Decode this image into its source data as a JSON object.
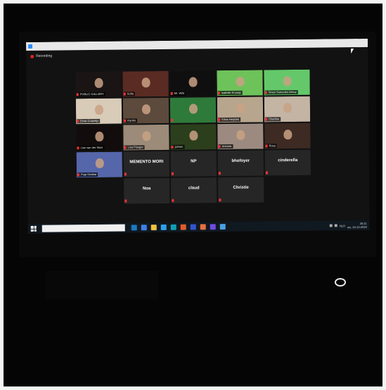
{
  "window": {
    "recording_label": "Recording"
  },
  "gallery": {
    "rows": [
      [
        {
          "name": "PUBLIC GALLERY",
          "video": "#1a1414"
        },
        {
          "name": "Sofia",
          "video": "#5a2b22"
        },
        {
          "name": "Mr. Wild",
          "video": "#0f0f0f"
        },
        {
          "name": "Isabelle Snoeijs",
          "video": "#6ec25a"
        },
        {
          "name": "Sinan Semerdzi Aksoy",
          "video": "#64c86a"
        }
      ],
      [
        {
          "name": "Ernst Corpelijn",
          "video": "#d8cbb8"
        },
        {
          "name": "mynke",
          "video": "#5c4a3c"
        },
        {
          "name": "",
          "video": "#2e7a3a"
        },
        {
          "name": "Silvia Heijstek",
          "video": "#b8a58d"
        },
        {
          "name": "Charline",
          "video": "#c4b4a4"
        }
      ],
      [
        {
          "name": "Lise van der Sluis",
          "video": "#120c0c"
        },
        {
          "name": "Lisa Ploeger",
          "video": "#9b8b78"
        },
        {
          "name": "jaimen",
          "video": "#2b3f1c"
        },
        {
          "name": "Antonia",
          "video": "#9c8a80"
        },
        {
          "name": "Rosa",
          "video": "#3d2a22"
        }
      ],
      [
        {
          "name": "Puja Sivakar",
          "video": "#5566aa"
        },
        {
          "name": "MEMENTO MORI",
          "video": ""
        },
        {
          "name": "NP",
          "video": ""
        },
        {
          "name": "bhofoyer",
          "video": ""
        },
        {
          "name": "cinderella",
          "video": ""
        }
      ],
      [
        {
          "name": "Noa",
          "video": ""
        },
        {
          "name": "claud",
          "video": ""
        },
        {
          "name": "Christie",
          "video": ""
        }
      ]
    ]
  },
  "taskbar": {
    "apps": [
      "#1a78c2",
      "#3f7ee8",
      "#f0c040",
      "#2ea0e8",
      "#10a0b0",
      "#e25b2a",
      "#3355cc",
      "#e87040",
      "#6c4ce0",
      "#4aa0e0"
    ],
    "clock_time": "20:21",
    "clock_date": "wo, 24-10-2020",
    "lang": "NLD"
  }
}
